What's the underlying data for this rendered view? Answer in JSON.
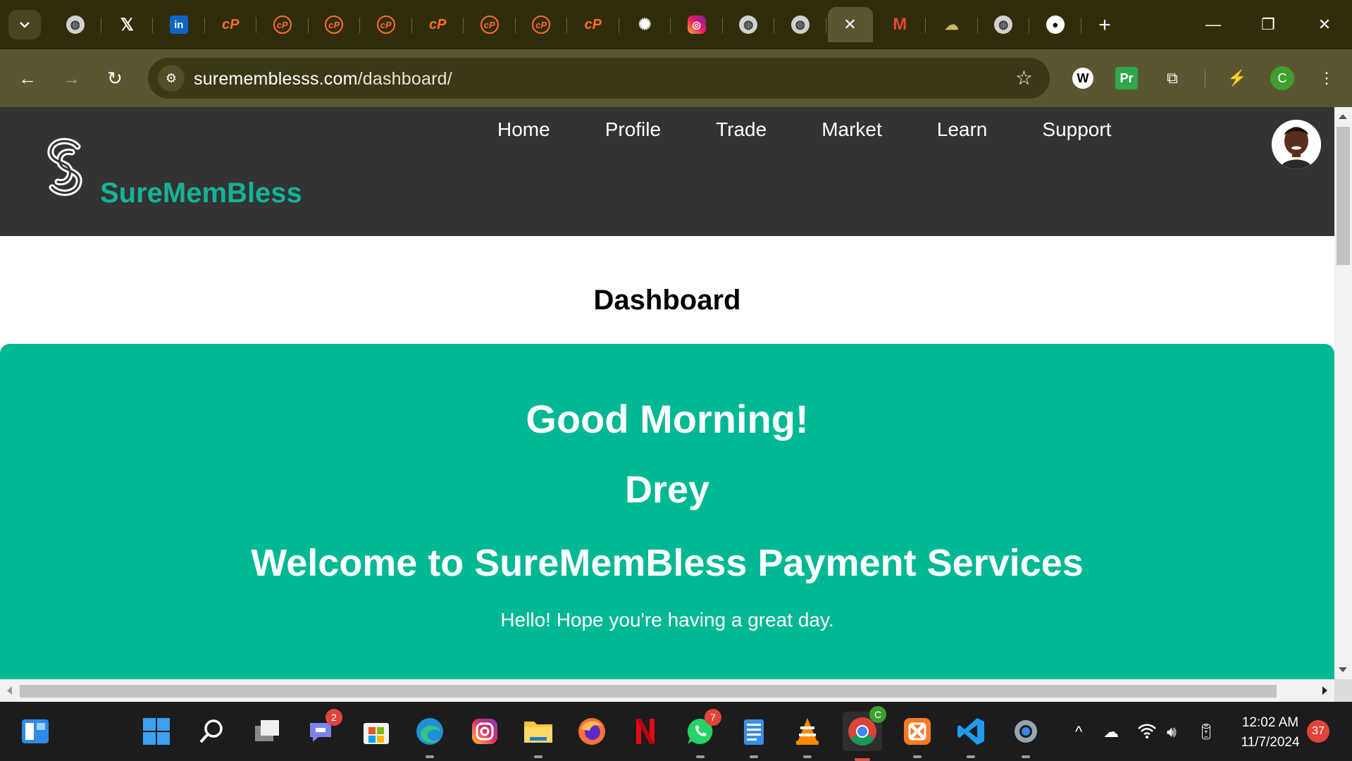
{
  "browser": {
    "tabs": [
      {
        "icon": "globe-icon",
        "glyph": "◍"
      },
      {
        "icon": "x-icon",
        "glyph": "𝕏"
      },
      {
        "icon": "linkedin-icon",
        "glyph": "in"
      },
      {
        "icon": "cpanel-icon",
        "glyph": "cP"
      },
      {
        "icon": "cpanel-circle-icon",
        "glyph": "cP"
      },
      {
        "icon": "cpanel-circle-icon",
        "glyph": "cP"
      },
      {
        "icon": "cpanel-circle-icon",
        "glyph": "cP"
      },
      {
        "icon": "cpanel-icon",
        "glyph": "cP"
      },
      {
        "icon": "cpanel-circle-icon",
        "glyph": "cP"
      },
      {
        "icon": "cpanel-circle-icon",
        "glyph": "cP"
      },
      {
        "icon": "cpanel-icon",
        "glyph": "cP"
      },
      {
        "icon": "openai-icon",
        "glyph": "✺"
      },
      {
        "icon": "instagram-icon",
        "glyph": "◎"
      },
      {
        "icon": "globe-icon",
        "glyph": "◍"
      },
      {
        "icon": "globe-icon",
        "glyph": "◍"
      },
      {
        "icon": "close-tab-icon",
        "glyph": "✕",
        "active": true
      },
      {
        "icon": "gmail-icon",
        "glyph": "M"
      },
      {
        "icon": "cloud-icon",
        "glyph": "☁"
      },
      {
        "icon": "globe-icon",
        "glyph": "◍"
      },
      {
        "icon": "github-icon",
        "glyph": "●"
      }
    ],
    "url_host": "surememblesss.com",
    "url_host_display": "surememble",
    "url": {
      "host": "surememblesss.com",
      "path": "/dashboard/"
    },
    "profile_initial": "C",
    "extension_w": "W",
    "extension_pr": "Pr"
  },
  "site": {
    "brand": "SureMemBless",
    "nav": [
      "Home",
      "Profile",
      "Trade",
      "Market",
      "Learn",
      "Support"
    ],
    "page_title": "Dashboard",
    "hero": {
      "greeting": "Good Morning!",
      "name": "Drey",
      "welcome": "Welcome to SureMemBless Payment Services",
      "subtitle": "Hello! Hope you're having a great day."
    },
    "colors": {
      "header_bg": "#333333",
      "brand": "#15b396",
      "hero_bg": "#00b894"
    }
  },
  "taskbar": {
    "teams_badge": "2",
    "whatsapp_badge": "7",
    "chrome_profile": "C",
    "time": "12:02 AM",
    "date": "11/7/2024",
    "notifications": "37"
  }
}
